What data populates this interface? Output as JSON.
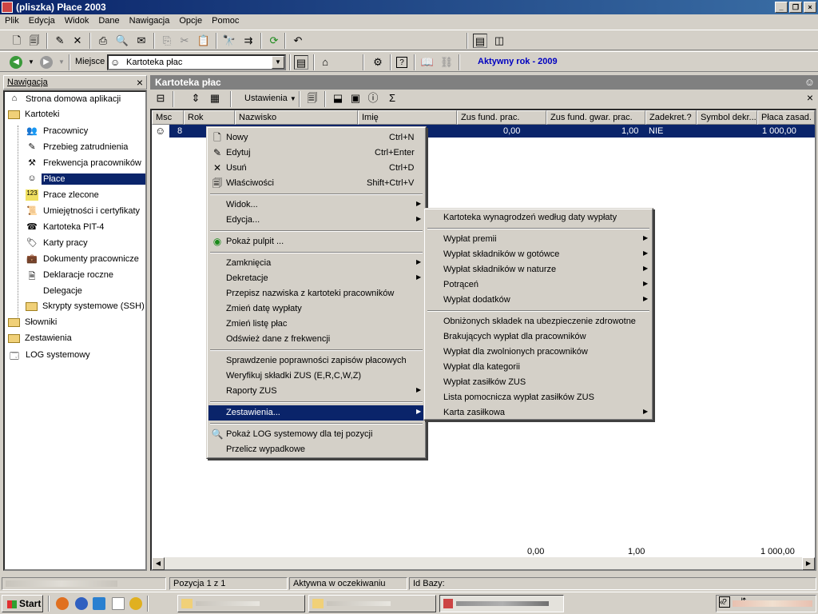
{
  "window": {
    "title": "(pliszka)  Płace 2003"
  },
  "menubar": [
    "Plik",
    "Edycja",
    "Widok",
    "Dane",
    "Nawigacja",
    "Opcje",
    "Pomoc"
  ],
  "location": {
    "label": "Miejsce",
    "value": "Kartoteka płac",
    "active_year": "Aktywny rok - 2009"
  },
  "navigation": {
    "title": "Nawigacja",
    "items": [
      {
        "label": "Strona domowa aplikacji",
        "icon": "home-icon"
      },
      {
        "label": "Kartoteki",
        "icon": "folder-open-icon"
      },
      {
        "label": "Pracownicy",
        "icon": "employees-icon"
      },
      {
        "label": "Przebieg zatrudnienia",
        "icon": "employment-icon"
      },
      {
        "label": "Frekwencja pracowników",
        "icon": "attendance-icon"
      },
      {
        "label": "Płace",
        "icon": "payroll-icon"
      },
      {
        "label": "Prace zlecone",
        "icon": "orders-icon"
      },
      {
        "label": "Umiejętności i certyfikaty",
        "icon": "certificate-icon"
      },
      {
        "label": "Kartoteka PIT-4",
        "icon": "pit-icon"
      },
      {
        "label": "Karty pracy",
        "icon": "workcard-icon"
      },
      {
        "label": "Dokumenty pracownicze",
        "icon": "documents-icon"
      },
      {
        "label": "Deklaracje roczne",
        "icon": "declaration-icon"
      },
      {
        "label": "Delegacje",
        "icon": ""
      },
      {
        "label": "Skrypty systemowe (SSH)",
        "icon": "folder-icon"
      },
      {
        "label": "Słowniki",
        "icon": "folder-icon"
      },
      {
        "label": "Zestawienia",
        "icon": "folder-icon"
      },
      {
        "label": "LOG systemowy",
        "icon": "log-icon"
      }
    ]
  },
  "main": {
    "title": "Kartoteka płac",
    "settings_label": "Ustawienia",
    "columns": [
      "Msc",
      "Rok",
      "Nazwisko",
      "Imię",
      "Zus fund. prac.",
      "Zus fund. gwar. prac.",
      "Zadekret.?",
      "Symbol dekr...",
      "Płaca zasad."
    ],
    "row": {
      "msc": "8",
      "zus_fund": "0,00",
      "zus_gwar": "1,00",
      "zadekret": "NIE",
      "placa": "1 000,00"
    },
    "totals": {
      "zus_fund": "0,00",
      "zus_gwar": "1,00",
      "placa": "1 000,00"
    }
  },
  "context_menu": {
    "items": [
      {
        "label": "Nowy",
        "shortcut": "Ctrl+N",
        "icon": "new-document-icon"
      },
      {
        "label": "Edytuj",
        "shortcut": "Ctrl+Enter",
        "icon": "edit-icon"
      },
      {
        "label": "Usuń",
        "shortcut": "Ctrl+D",
        "icon": "delete-icon"
      },
      {
        "label": "Właściwości",
        "shortcut": "Shift+Ctrl+V",
        "icon": "properties-icon"
      },
      {
        "label": "Widok...",
        "submenu": true
      },
      {
        "label": "Edycja...",
        "submenu": true
      },
      {
        "label": "Pokaż pulpit ...",
        "icon": "desktop-icon"
      },
      {
        "label": "Zamknięcia",
        "submenu": true
      },
      {
        "label": "Dekretacje",
        "submenu": true
      },
      {
        "label": "Przepisz nazwiska z kartoteki pracowników"
      },
      {
        "label": "Zmień datę wypłaty"
      },
      {
        "label": "Zmień listę płac"
      },
      {
        "label": "Odśwież dane z frekwencji"
      },
      {
        "label": "Sprawdzenie poprawności zapisów płacowych"
      },
      {
        "label": "Weryfikuj składki ZUS (E,R,C,W,Z)"
      },
      {
        "label": "Raporty ZUS",
        "submenu": true
      },
      {
        "label": "Zestawienia...",
        "submenu": true,
        "highlighted": true
      },
      {
        "label": "Pokaż LOG systemowy dla tej pozycji",
        "icon": "search-icon"
      },
      {
        "label": "Przelicz wypadkowe"
      }
    ]
  },
  "submenu": {
    "items": [
      {
        "label": "Kartoteka wynagrodzeń według daty wypłaty"
      },
      {
        "label": "Wypłat premii",
        "submenu": true
      },
      {
        "label": "Wypłat składników w gotówce",
        "submenu": true
      },
      {
        "label": "Wypłat składników w naturze",
        "submenu": true
      },
      {
        "label": "Potrąceń",
        "submenu": true
      },
      {
        "label": "Wypłat dodatków",
        "submenu": true
      },
      {
        "label": "Obniżonych składek na ubezpieczenie zdrowotne"
      },
      {
        "label": "Brakujących wypłat dla pracowników"
      },
      {
        "label": "Wypłat dla zwolnionych pracowników"
      },
      {
        "label": "Wypłat dla kategorii"
      },
      {
        "label": "Wypłat zasiłków ZUS"
      },
      {
        "label": "Lista pomocnicza wypłat zasiłków ZUS"
      },
      {
        "label": "Karta zasiłkowa",
        "submenu": true
      }
    ]
  },
  "status": {
    "position": "Pozycja 1 z 1",
    "state": "Aktywna w oczekiwaniu",
    "db_label": "Id Bazy:"
  },
  "taskbar": {
    "start": "Start"
  },
  "colors": {
    "titlebar": "#0a246a",
    "selection": "#0a246a",
    "chrome": "#d4d0c8",
    "year_text": "#0000c0"
  }
}
